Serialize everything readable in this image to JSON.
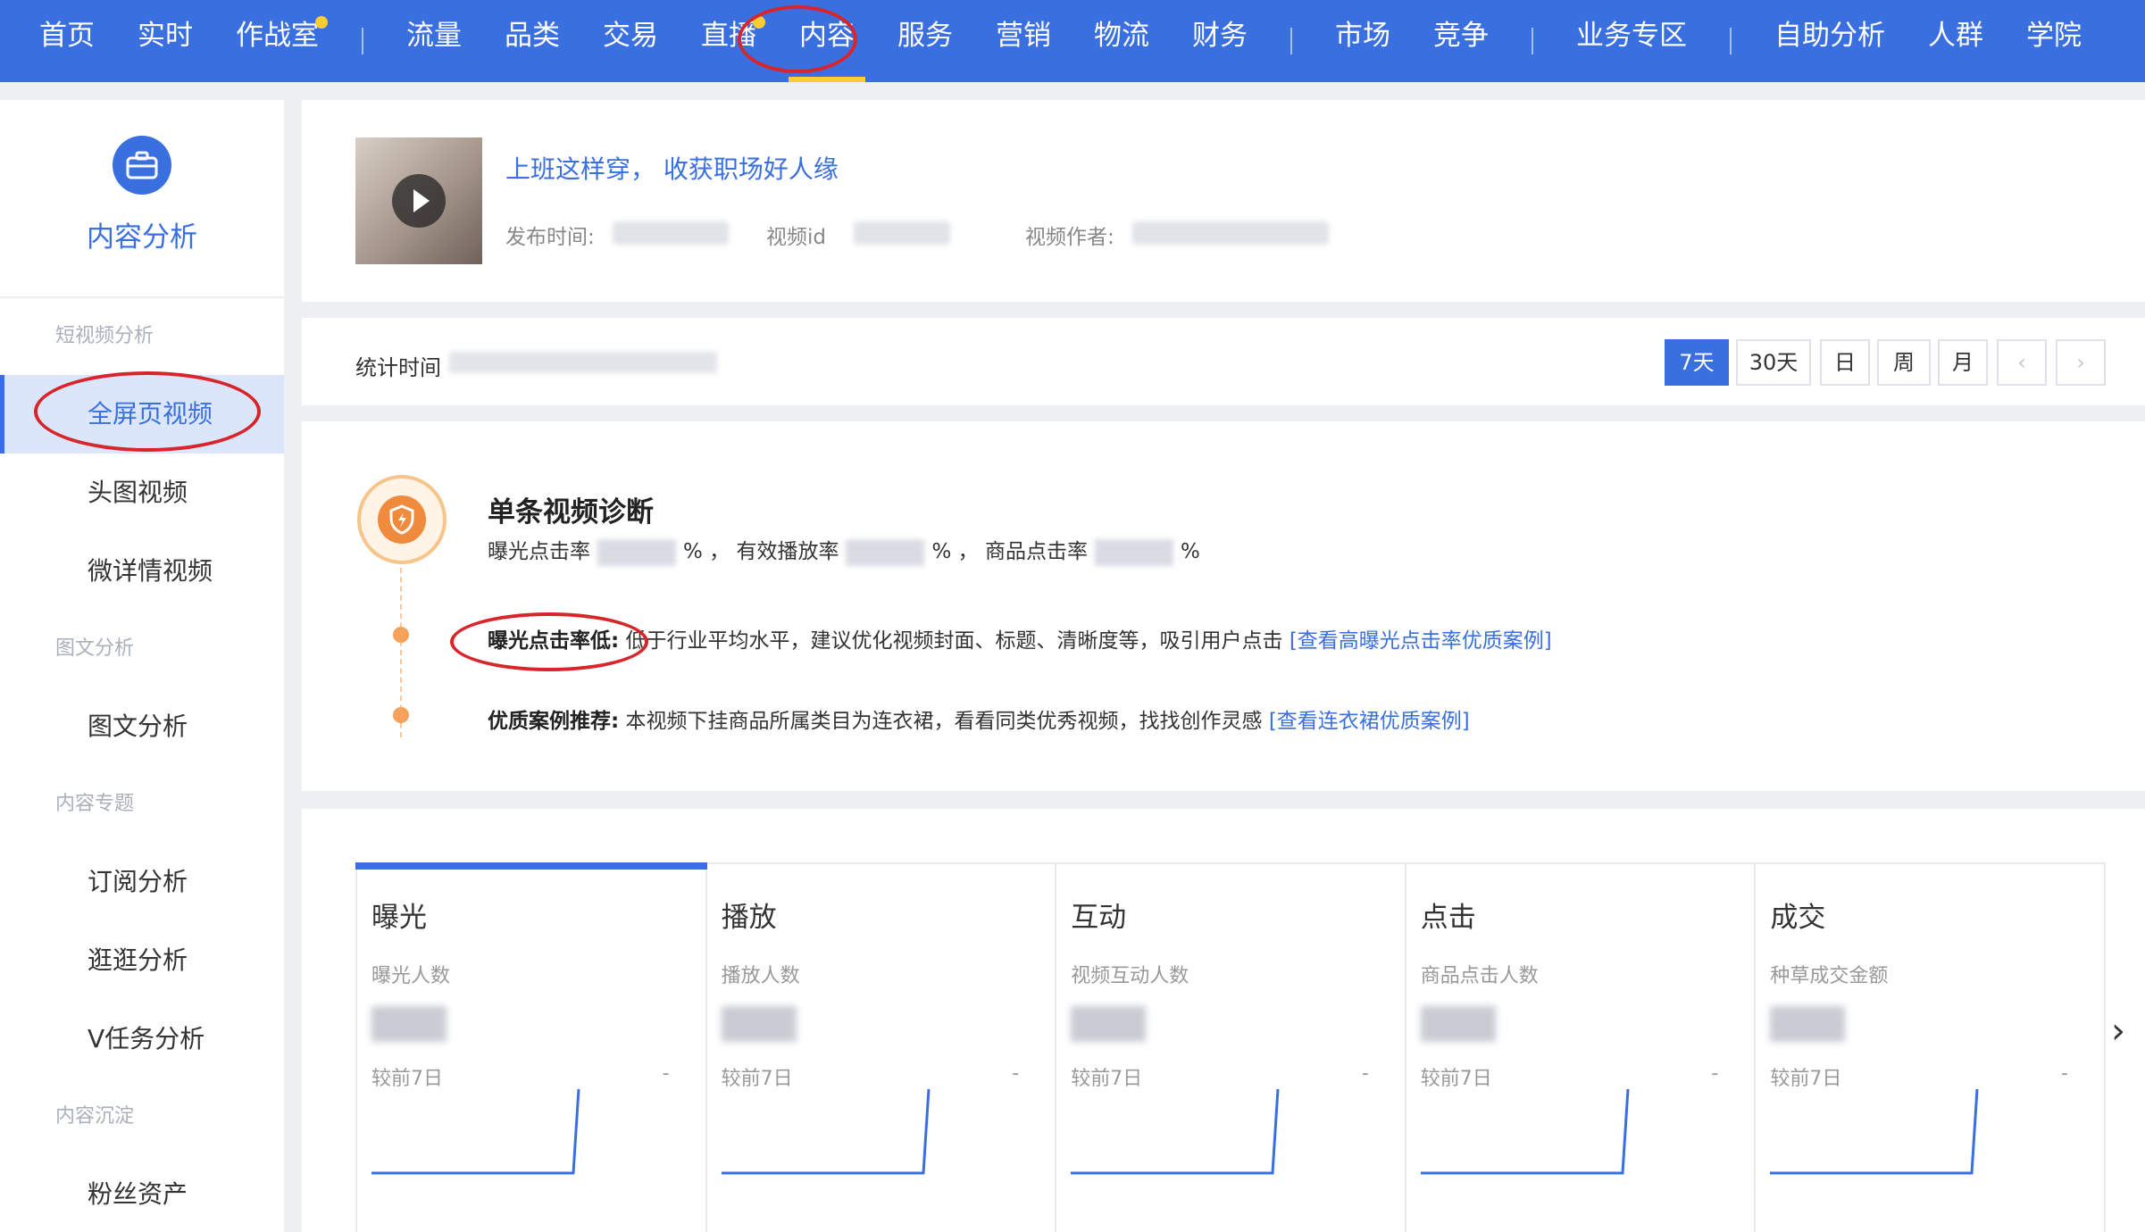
{
  "topnav": {
    "items": [
      {
        "label": "首页"
      },
      {
        "label": "实时"
      },
      {
        "label": "作战室",
        "dot": true
      },
      {
        "sep": true
      },
      {
        "label": "流量"
      },
      {
        "label": "品类"
      },
      {
        "label": "交易"
      },
      {
        "label": "直播",
        "dot": true
      },
      {
        "label": "内容",
        "active": true
      },
      {
        "label": "服务"
      },
      {
        "label": "营销"
      },
      {
        "label": "物流"
      },
      {
        "label": "财务"
      },
      {
        "sep": true
      },
      {
        "label": "市场"
      },
      {
        "label": "竞争"
      },
      {
        "sep": true
      },
      {
        "label": "业务专区"
      },
      {
        "sep": true
      },
      {
        "label": "自助分析"
      },
      {
        "label": "人群"
      },
      {
        "label": "学院"
      }
    ]
  },
  "sidebar": {
    "title": "内容分析",
    "groups": [
      {
        "label": "短视频分析",
        "items": [
          "全屏页视频",
          "头图视频",
          "微详情视频"
        ]
      },
      {
        "label": "图文分析",
        "items": [
          "图文分析"
        ]
      },
      {
        "label": "内容专题",
        "items": [
          "订阅分析",
          "逛逛分析",
          "V任务分析"
        ]
      },
      {
        "label": "内容沉淀",
        "items": [
          "粉丝资产"
        ]
      }
    ],
    "active_item": "全屏页视频"
  },
  "video": {
    "title": "上班这样穿， 收获职场好人缘",
    "publish_label": "发布时间:",
    "id_label": "视频id",
    "author_label": "视频作者:"
  },
  "stat": {
    "label": "统计时间",
    "ranges": [
      "7天",
      "30天",
      "日",
      "周",
      "月"
    ],
    "active_range": "7天",
    "prev": "‹",
    "next": "›"
  },
  "diagnosis": {
    "title": "单条视频诊断",
    "rate1_label": "曝光点击率",
    "rate1_suffix": "%",
    "rate2_label": "， 有效播放率",
    "rate2_suffix": "%",
    "rate3_label": "， 商品点击率",
    "rate3_suffix": "%",
    "tip1_title": "曝光点击率低:",
    "tip1_text": "低于行业平均水平，建议优化视频封面、标题、清晰度等，吸引用户点击",
    "tip1_link": "[查看高曝光点击率优质案例]",
    "tip2_title": "优质案例推荐:",
    "tip2_text": "本视频下挂商品所属类目为连衣裙，看看同类优秀视频，找找创作灵感",
    "tip2_link": "[查看连衣裙优质案例]"
  },
  "metrics": [
    {
      "name": "曝光",
      "sub": "曝光人数",
      "compare": "较前7日",
      "dash": "-",
      "active": true
    },
    {
      "name": "播放",
      "sub": "播放人数",
      "compare": "较前7日",
      "dash": "-"
    },
    {
      "name": "互动",
      "sub": "视频互动人数",
      "compare": "较前7日",
      "dash": "-"
    },
    {
      "name": "点击",
      "sub": "商品点击人数",
      "compare": "较前7日",
      "dash": "-"
    },
    {
      "name": "成交",
      "sub": "种草成交金额",
      "compare": "较前7日",
      "dash": "-"
    }
  ],
  "colors": {
    "primary": "#3a6fe0",
    "nav_active_underline": "#ffcc33",
    "annotation": "#d8252b",
    "warning": "#f08a3c"
  }
}
